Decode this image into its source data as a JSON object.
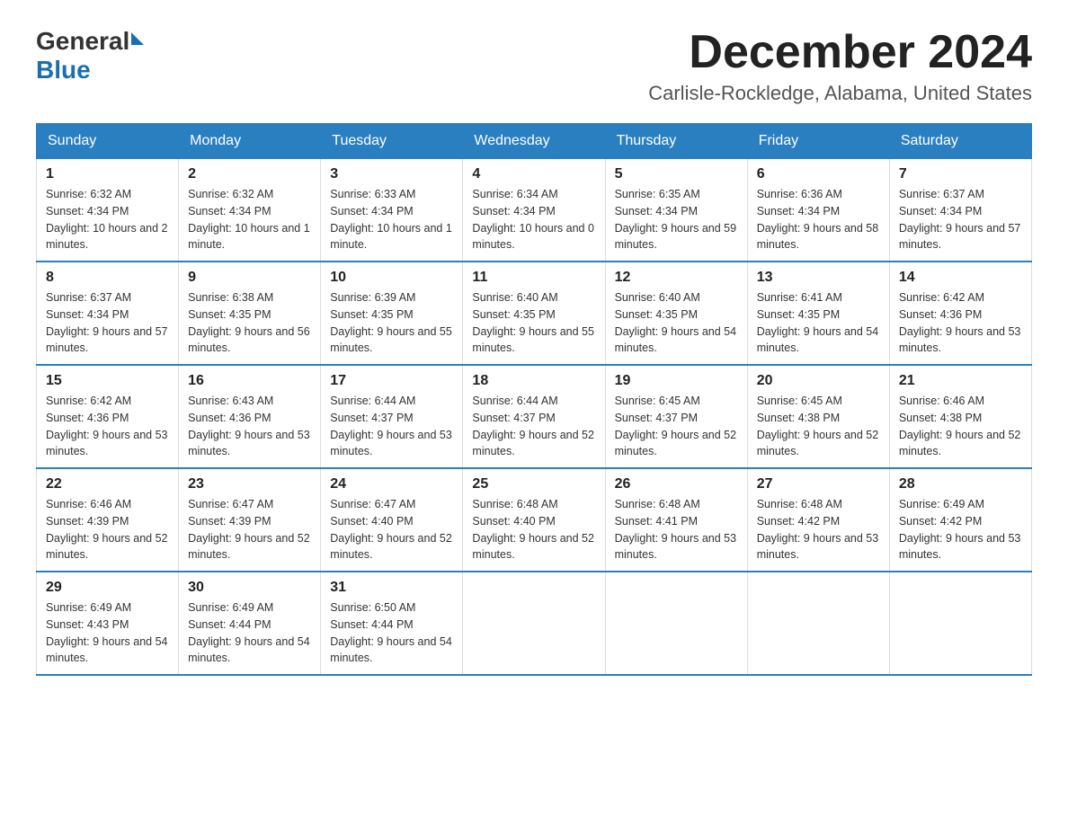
{
  "logo": {
    "general": "General",
    "blue": "Blue"
  },
  "title": "December 2024",
  "subtitle": "Carlisle-Rockledge, Alabama, United States",
  "days_of_week": [
    "Sunday",
    "Monday",
    "Tuesday",
    "Wednesday",
    "Thursday",
    "Friday",
    "Saturday"
  ],
  "weeks": [
    [
      {
        "day": "1",
        "sunrise": "Sunrise: 6:32 AM",
        "sunset": "Sunset: 4:34 PM",
        "daylight": "Daylight: 10 hours and 2 minutes."
      },
      {
        "day": "2",
        "sunrise": "Sunrise: 6:32 AM",
        "sunset": "Sunset: 4:34 PM",
        "daylight": "Daylight: 10 hours and 1 minute."
      },
      {
        "day": "3",
        "sunrise": "Sunrise: 6:33 AM",
        "sunset": "Sunset: 4:34 PM",
        "daylight": "Daylight: 10 hours and 1 minute."
      },
      {
        "day": "4",
        "sunrise": "Sunrise: 6:34 AM",
        "sunset": "Sunset: 4:34 PM",
        "daylight": "Daylight: 10 hours and 0 minutes."
      },
      {
        "day": "5",
        "sunrise": "Sunrise: 6:35 AM",
        "sunset": "Sunset: 4:34 PM",
        "daylight": "Daylight: 9 hours and 59 minutes."
      },
      {
        "day": "6",
        "sunrise": "Sunrise: 6:36 AM",
        "sunset": "Sunset: 4:34 PM",
        "daylight": "Daylight: 9 hours and 58 minutes."
      },
      {
        "day": "7",
        "sunrise": "Sunrise: 6:37 AM",
        "sunset": "Sunset: 4:34 PM",
        "daylight": "Daylight: 9 hours and 57 minutes."
      }
    ],
    [
      {
        "day": "8",
        "sunrise": "Sunrise: 6:37 AM",
        "sunset": "Sunset: 4:34 PM",
        "daylight": "Daylight: 9 hours and 57 minutes."
      },
      {
        "day": "9",
        "sunrise": "Sunrise: 6:38 AM",
        "sunset": "Sunset: 4:35 PM",
        "daylight": "Daylight: 9 hours and 56 minutes."
      },
      {
        "day": "10",
        "sunrise": "Sunrise: 6:39 AM",
        "sunset": "Sunset: 4:35 PM",
        "daylight": "Daylight: 9 hours and 55 minutes."
      },
      {
        "day": "11",
        "sunrise": "Sunrise: 6:40 AM",
        "sunset": "Sunset: 4:35 PM",
        "daylight": "Daylight: 9 hours and 55 minutes."
      },
      {
        "day": "12",
        "sunrise": "Sunrise: 6:40 AM",
        "sunset": "Sunset: 4:35 PM",
        "daylight": "Daylight: 9 hours and 54 minutes."
      },
      {
        "day": "13",
        "sunrise": "Sunrise: 6:41 AM",
        "sunset": "Sunset: 4:35 PM",
        "daylight": "Daylight: 9 hours and 54 minutes."
      },
      {
        "day": "14",
        "sunrise": "Sunrise: 6:42 AM",
        "sunset": "Sunset: 4:36 PM",
        "daylight": "Daylight: 9 hours and 53 minutes."
      }
    ],
    [
      {
        "day": "15",
        "sunrise": "Sunrise: 6:42 AM",
        "sunset": "Sunset: 4:36 PM",
        "daylight": "Daylight: 9 hours and 53 minutes."
      },
      {
        "day": "16",
        "sunrise": "Sunrise: 6:43 AM",
        "sunset": "Sunset: 4:36 PM",
        "daylight": "Daylight: 9 hours and 53 minutes."
      },
      {
        "day": "17",
        "sunrise": "Sunrise: 6:44 AM",
        "sunset": "Sunset: 4:37 PM",
        "daylight": "Daylight: 9 hours and 53 minutes."
      },
      {
        "day": "18",
        "sunrise": "Sunrise: 6:44 AM",
        "sunset": "Sunset: 4:37 PM",
        "daylight": "Daylight: 9 hours and 52 minutes."
      },
      {
        "day": "19",
        "sunrise": "Sunrise: 6:45 AM",
        "sunset": "Sunset: 4:37 PM",
        "daylight": "Daylight: 9 hours and 52 minutes."
      },
      {
        "day": "20",
        "sunrise": "Sunrise: 6:45 AM",
        "sunset": "Sunset: 4:38 PM",
        "daylight": "Daylight: 9 hours and 52 minutes."
      },
      {
        "day": "21",
        "sunrise": "Sunrise: 6:46 AM",
        "sunset": "Sunset: 4:38 PM",
        "daylight": "Daylight: 9 hours and 52 minutes."
      }
    ],
    [
      {
        "day": "22",
        "sunrise": "Sunrise: 6:46 AM",
        "sunset": "Sunset: 4:39 PM",
        "daylight": "Daylight: 9 hours and 52 minutes."
      },
      {
        "day": "23",
        "sunrise": "Sunrise: 6:47 AM",
        "sunset": "Sunset: 4:39 PM",
        "daylight": "Daylight: 9 hours and 52 minutes."
      },
      {
        "day": "24",
        "sunrise": "Sunrise: 6:47 AM",
        "sunset": "Sunset: 4:40 PM",
        "daylight": "Daylight: 9 hours and 52 minutes."
      },
      {
        "day": "25",
        "sunrise": "Sunrise: 6:48 AM",
        "sunset": "Sunset: 4:40 PM",
        "daylight": "Daylight: 9 hours and 52 minutes."
      },
      {
        "day": "26",
        "sunrise": "Sunrise: 6:48 AM",
        "sunset": "Sunset: 4:41 PM",
        "daylight": "Daylight: 9 hours and 53 minutes."
      },
      {
        "day": "27",
        "sunrise": "Sunrise: 6:48 AM",
        "sunset": "Sunset: 4:42 PM",
        "daylight": "Daylight: 9 hours and 53 minutes."
      },
      {
        "day": "28",
        "sunrise": "Sunrise: 6:49 AM",
        "sunset": "Sunset: 4:42 PM",
        "daylight": "Daylight: 9 hours and 53 minutes."
      }
    ],
    [
      {
        "day": "29",
        "sunrise": "Sunrise: 6:49 AM",
        "sunset": "Sunset: 4:43 PM",
        "daylight": "Daylight: 9 hours and 54 minutes."
      },
      {
        "day": "30",
        "sunrise": "Sunrise: 6:49 AM",
        "sunset": "Sunset: 4:44 PM",
        "daylight": "Daylight: 9 hours and 54 minutes."
      },
      {
        "day": "31",
        "sunrise": "Sunrise: 6:50 AM",
        "sunset": "Sunset: 4:44 PM",
        "daylight": "Daylight: 9 hours and 54 minutes."
      },
      null,
      null,
      null,
      null
    ]
  ]
}
